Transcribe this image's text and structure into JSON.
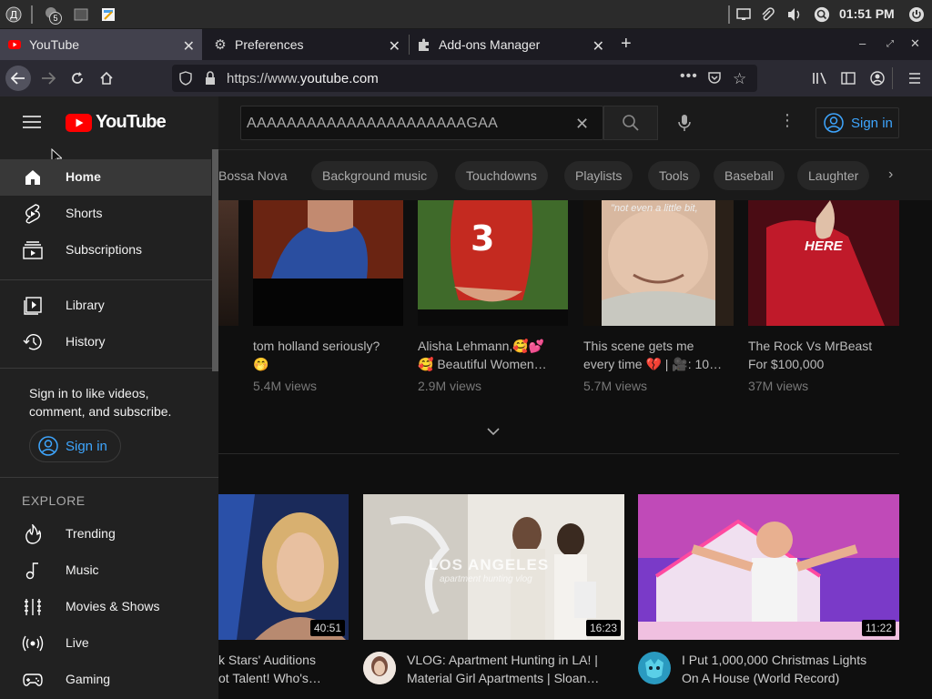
{
  "system": {
    "clock": "01:51 PM",
    "badge_count": "5"
  },
  "tabs": [
    {
      "title": "YouTube",
      "active": true
    },
    {
      "title": "Preferences",
      "active": false
    },
    {
      "title": "Add-ons Manager",
      "active": false
    }
  ],
  "navbar": {
    "url_prefix": "https://www.",
    "url_domain": "youtube.com"
  },
  "youtube": {
    "logo_text": "YouTube",
    "search_value": "AAAAAAAAAAAAAAAAAAAAAAGAA",
    "sign_in_top": "Sign in"
  },
  "chips": [
    "Bossa Nova",
    "Background music",
    "Touchdowns",
    "Playlists",
    "Tools",
    "Baseball",
    "Laughter"
  ],
  "shorts_row": [
    {
      "title1": "tom holland seriously?",
      "title2": "🤭",
      "views": "5.4M views"
    },
    {
      "title1": "Alisha Lehmann,🥰💕",
      "title2": "🥰 Beautiful Women…",
      "views": "2.9M views"
    },
    {
      "title1": "This scene gets me",
      "title2": "every time 💔 | 🎥: 10…",
      "views": "5.7M views",
      "overlay": "\"not even a little bit,"
    },
    {
      "title1": "The Rock Vs MrBeast",
      "title2": "For $100,000",
      "views": "37M views",
      "overlay": "HERE"
    }
  ],
  "videos": [
    {
      "title1": "k Stars' Auditions",
      "title2": "ot Talent! Who's…",
      "duration": "40:51"
    },
    {
      "title1": "VLOG: Apartment Hunting in LA! |",
      "title2": "Material Girl Apartments | Sloan…",
      "duration": "16:23",
      "overlay": "LOS ANGELES",
      "overlay2": "apartment hunting vlog"
    },
    {
      "title1": "I Put 1,000,000 Christmas Lights",
      "title2": "On A House (World Record)",
      "duration": "11:22"
    }
  ],
  "sidebar": {
    "main": [
      {
        "label": "Home",
        "icon": "home-icon"
      },
      {
        "label": "Shorts",
        "icon": "shorts-icon"
      },
      {
        "label": "Subscriptions",
        "icon": "subscriptions-icon"
      }
    ],
    "library": [
      {
        "label": "Library",
        "icon": "library-icon"
      },
      {
        "label": "History",
        "icon": "history-icon"
      }
    ],
    "signin_prompt1": "Sign in to like videos,",
    "signin_prompt2": "comment, and subscribe.",
    "signin_button": "Sign in",
    "explore_heading": "EXPLORE",
    "explore": [
      {
        "label": "Trending",
        "icon": "trending-icon"
      },
      {
        "label": "Music",
        "icon": "music-icon"
      },
      {
        "label": "Movies & Shows",
        "icon": "movies-icon"
      },
      {
        "label": "Live",
        "icon": "live-icon"
      },
      {
        "label": "Gaming",
        "icon": "gaming-icon"
      }
    ]
  },
  "colors": {
    "youtube_red": "#ff0000",
    "link_blue": "#3ea6ff"
  }
}
